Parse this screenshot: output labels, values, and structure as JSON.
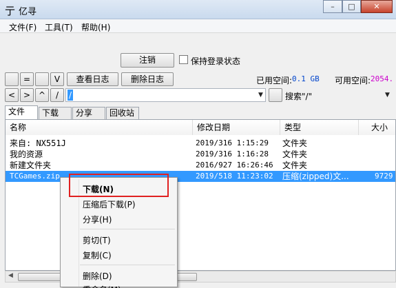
{
  "window": {
    "icon": "亍",
    "title": "亿寻",
    "minimize": "–",
    "maximize": "□",
    "close": "✕"
  },
  "menubar": [
    "文件(F)",
    "工具(T)",
    "帮助(H)"
  ],
  "login": {
    "logout_label": "注销",
    "keep_login_label": "保持登录状态"
  },
  "toolbar": {
    "btn_equal": "=",
    "btn_v": "V",
    "view_log": "查看日志",
    "delete_log": "删除日志",
    "used_label": "已用空间:",
    "used_value": "0.1 GB",
    "avail_label": "可用空间:",
    "avail_value": "2054."
  },
  "nav": {
    "back": "<",
    "forward": ">",
    "up": "^",
    "root": "/",
    "path": "/",
    "search_text": "搜索\"/\""
  },
  "tabs": [
    "文件",
    "下载",
    "分享",
    "回收站"
  ],
  "columns": [
    "名称",
    "修改日期",
    "类型",
    "大小"
  ],
  "rows": [
    {
      "name": "来自: NX551J",
      "date": "2019/316 1:15:29",
      "type": "文件夹",
      "size": ""
    },
    {
      "name": "我的资源",
      "date": "2019/316 1:16:28",
      "type": "文件夹",
      "size": ""
    },
    {
      "name": "新建文件夹",
      "date": "2016/927 16:26:46",
      "type": "文件夹",
      "size": ""
    },
    {
      "name": "TCGames.zip",
      "date": "2019/518 11:23:02",
      "type": "压缩(zipped)文...",
      "size": "9729"
    }
  ],
  "context_menu": [
    "下载(N)",
    "压缩后下载(P)",
    "分享(H)",
    "剪切(T)",
    "复制(C)",
    "删除(D)",
    "重命名(M)"
  ],
  "colors": {
    "selection": "#3399ff",
    "highlight_box": "#e02020",
    "accent_value": "#cc00cc",
    "used_value": "#0044cc"
  }
}
